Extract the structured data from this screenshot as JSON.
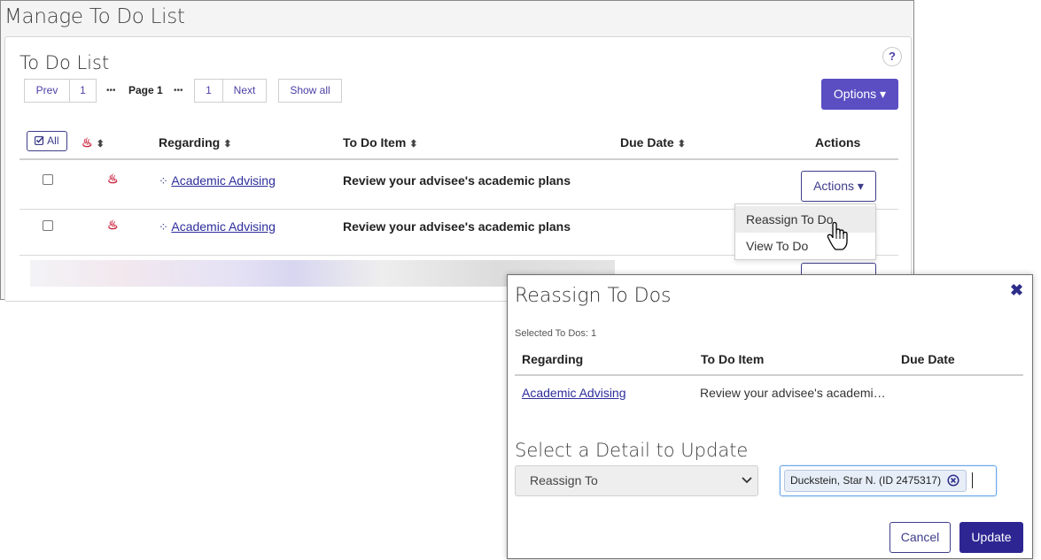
{
  "main": {
    "title": "Manage To Do List",
    "list_title": "To Do List",
    "help_label": "?",
    "pagination": {
      "prev": "Prev",
      "first": "1",
      "ellipsis": "•••",
      "current": "Page 1",
      "last": "1",
      "next": "Next",
      "show_all": "Show all"
    },
    "options_label": "Options ▾",
    "columns": {
      "all": "All",
      "regarding": "Regarding",
      "item": "To Do Item",
      "due": "Due Date",
      "actions": "Actions"
    },
    "rows": [
      {
        "regarding": "Academic Advising",
        "item": "Review your advisee's academic plans",
        "due": "",
        "actions_label": "Actions ▾"
      },
      {
        "regarding": "Academic Advising",
        "item": "Review your advisee's academic plans",
        "due": ""
      }
    ],
    "row_actions_menu": [
      "Reassign To Do",
      "View To Do"
    ]
  },
  "modal": {
    "title": "Reassign To Dos",
    "selected_count": "Selected To Dos: 1",
    "columns": {
      "regarding": "Regarding",
      "item": "To Do Item",
      "due": "Due Date"
    },
    "row": {
      "regarding": "Academic Advising",
      "item": "Review your advisee's academi…",
      "due": ""
    },
    "detail_title": "Select a Detail to Update",
    "select_value": "Reassign To",
    "person_chip": "Duckstein, Star N. (ID 2475317)",
    "cancel_label": "Cancel",
    "update_label": "Update"
  },
  "colors": {
    "primary": "#5a4ec2",
    "primary_dark": "#2d2692",
    "link": "#2d2d9c",
    "flame": "#c8203a"
  },
  "icons": [
    "question-icon",
    "flame-icon",
    "sort-icon",
    "check-all-icon",
    "network-icon",
    "chevron-down-icon",
    "hand-pointer-icon",
    "close-icon",
    "remove-circle-icon"
  ]
}
